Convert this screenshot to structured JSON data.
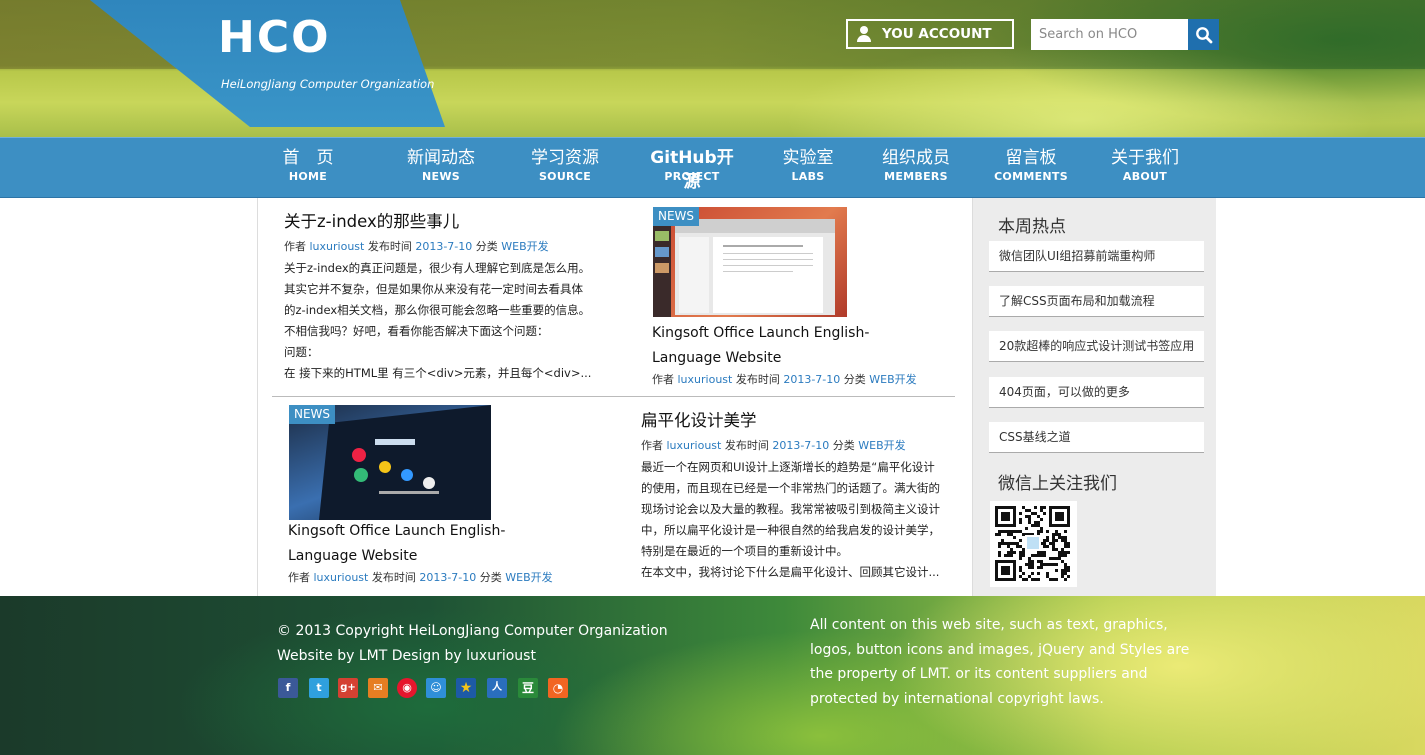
{
  "header": {
    "logo_title": "HCO",
    "logo_subtitle": "HeiLongJiang Computer Organization",
    "account_label": "YOU ACCOUNT",
    "search_placeholder": "Search on HCO"
  },
  "nav": [
    {
      "cn": "首　页",
      "en": "HOME"
    },
    {
      "cn": "新闻动态",
      "en": "NEWS"
    },
    {
      "cn": "学习资源",
      "en": "SOURCE"
    },
    {
      "cn": "GitHub开源",
      "en": "PROJECT"
    },
    {
      "cn": "实验室",
      "en": "LABS"
    },
    {
      "cn": "组织成员",
      "en": "MEMBERS"
    },
    {
      "cn": "留言板",
      "en": "COMMENTS"
    },
    {
      "cn": "关于我们",
      "en": "ABOUT"
    }
  ],
  "posts": {
    "p1": {
      "title": "关于z-index的那些事儿",
      "author_label": "作者",
      "author": "luxurioust",
      "date_label": "发布时间",
      "date": "2013-7-10",
      "cat_label": "分类",
      "category": "WEB开发",
      "excerpt": [
        "关于z-index的真正问题是，很少有人理解它到底是怎么用。",
        "其实它并不复杂，但是如果你从来没有花一定时间去看具体",
        "的z-index相关文档，那么你很可能会忽略一些重要的信息。",
        "不相信我吗？好吧，看看你能否解决下面这个问题：",
        "问题：",
        "在 接下来的HTML里 有三个<div>元素，并且每个<div>..."
      ]
    },
    "p2": {
      "badge": "NEWS",
      "title_line1": "Kingsoft Office Launch English-",
      "title_line2": "Language Website",
      "author_label": "作者",
      "author": "luxurioust",
      "date_label": "发布时间",
      "date": "2013-7-10",
      "cat_label": "分类",
      "category": "WEB开发"
    },
    "p3": {
      "badge": "NEWS",
      "title_line1": "Kingsoft Office Launch English-",
      "title_line2": "Language Website",
      "author_label": "作者",
      "author": "luxurioust",
      "date_label": "发布时间",
      "date": "2013-7-10",
      "cat_label": "分类",
      "category": "WEB开发"
    },
    "p4": {
      "title": "扁平化设计美学",
      "author_label": "作者",
      "author": "luxurioust",
      "date_label": "发布时间",
      "date": "2013-7-10",
      "cat_label": "分类",
      "category": "WEB开发",
      "excerpt": [
        "最近一个在网页和UI设计上逐渐增长的趋势是“扁平化设计",
        "的使用，而且现在已经是一个非常热门的话题了。满大街的",
        "现场讨论会以及大量的教程。我常常被吸引到极简主义设计",
        "中，所以扁平化设计是一种很自然的给我启发的设计美学，",
        "特别是在最近的一个项目的重新设计中。",
        "在本文中，我将讨论下什么是扁平化设计、回顾其它设计..."
      ]
    }
  },
  "sidebar": {
    "hot_title": "本周热点",
    "hot_items": [
      "微信团队UI组招募前端重构师",
      "了解CSS页面布局和加载流程",
      "20款超棒的响应式设计测试书签应用",
      "404页面，可以做的更多",
      "CSS基线之道"
    ],
    "wechat_title": "微信上关注我们"
  },
  "footer": {
    "copyright": "© 2013 Copyright HeiLongJiang Computer Organization",
    "credit": "Website by LMT Design by luxurioust",
    "notice": "All content on this web site, such as text, graphics, logos, button icons and images, jQuery and Styles are the property of LMT. or its content suppliers and protected by international copyright laws."
  },
  "colors": {
    "nav_blue": "#3d8fc3",
    "link_blue": "#2b7bbf",
    "search_btn": "#1f6fae"
  },
  "social_icons": [
    "facebook-icon",
    "twitter-icon",
    "google-plus-icon",
    "mail-icon",
    "weibo-icon",
    "qzone-icon",
    "star-icon",
    "renren-icon",
    "douban-icon",
    "rss-icon"
  ]
}
